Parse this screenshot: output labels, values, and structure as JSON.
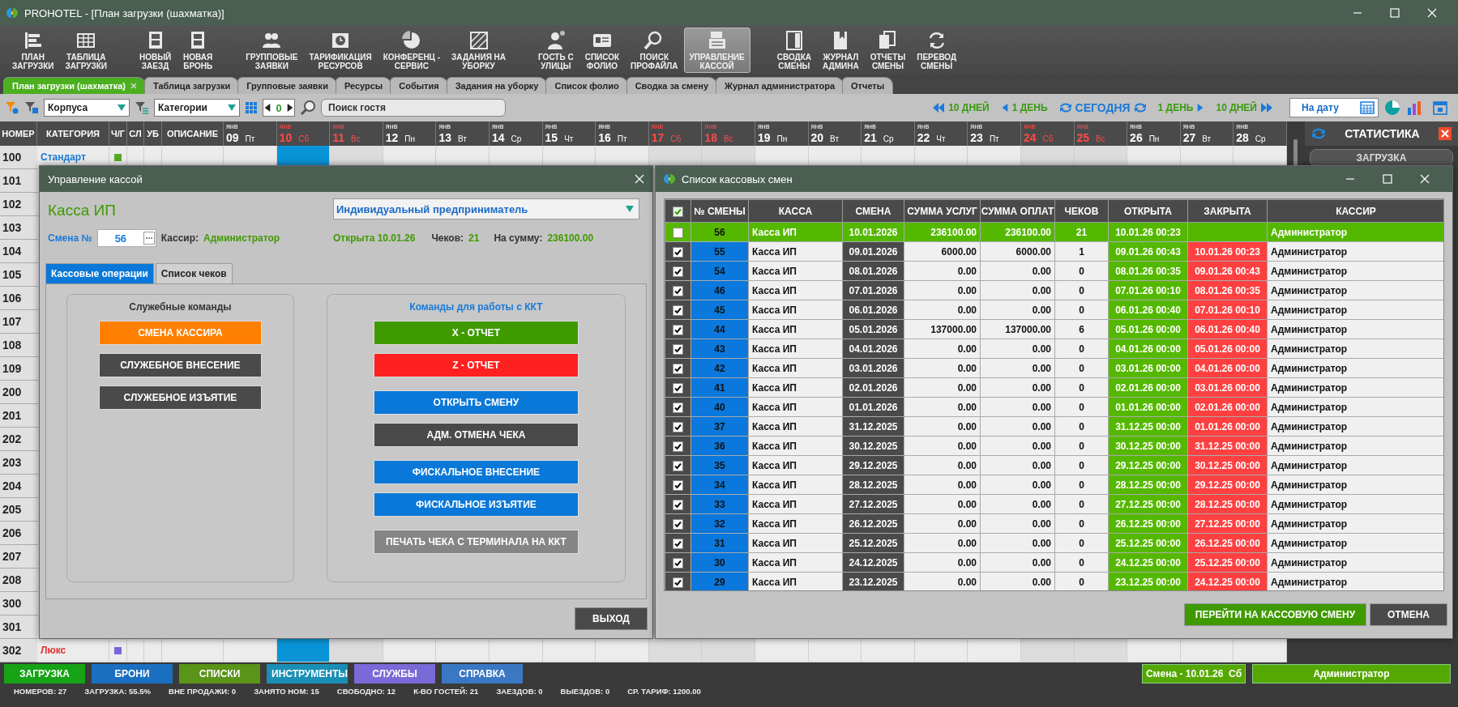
{
  "window": {
    "title": "PROHOTEL - [План загрузки (шахматка)]"
  },
  "toolbar": [
    {
      "label": "ПЛАН\nЗАГРУЗКИ",
      "selected": false
    },
    {
      "label": "ТАБЛИЦА\nЗАГРУЗКИ",
      "selected": false
    },
    {
      "label": "НОВЫЙ\nЗАЕЗД",
      "selected": false
    },
    {
      "label": "НОВАЯ\nБРОНЬ",
      "selected": false
    },
    {
      "label": "ГРУППОВЫЕ\nЗАЯВКИ",
      "selected": false
    },
    {
      "label": "ТАРИФИКАЦИЯ\nРЕСУРСОВ",
      "selected": false
    },
    {
      "label": "КОНФЕРЕНЦ -\nСЕРВИС",
      "selected": false
    },
    {
      "label": "ЗАДАНИЯ НА\nУБОРКУ",
      "selected": false
    },
    {
      "label": "ГОСТЬ С\nУЛИЦЫ",
      "selected": false
    },
    {
      "label": "СПИСОК\nФОЛИО",
      "selected": false
    },
    {
      "label": "ПОИСК\nПРОФАЙЛА",
      "selected": false
    },
    {
      "label": "УПРАВЛЕНИЕ\nКАССОЙ",
      "selected": true
    },
    {
      "label": "СВОДКА\nСМЕНЫ",
      "selected": false
    },
    {
      "label": "ЖУРНАЛ\nАДМИНА",
      "selected": false
    },
    {
      "label": "ОТЧЕТЫ\nСМЕНЫ",
      "selected": false
    },
    {
      "label": "ПЕРЕВОД\nСМЕНЫ",
      "selected": false
    }
  ],
  "tabs": [
    {
      "label": "План загрузки (шахматка)",
      "selected": true,
      "closable": true
    },
    {
      "label": "Таблица загрузки",
      "selected": false,
      "closable": false
    },
    {
      "label": "Групповые заявки",
      "selected": false,
      "closable": false
    },
    {
      "label": "Ресурсы",
      "selected": false,
      "closable": false
    },
    {
      "label": "События",
      "selected": false,
      "closable": false
    },
    {
      "label": "Задания на уборку",
      "selected": false,
      "closable": false
    },
    {
      "label": "Список фолио",
      "selected": false,
      "closable": false
    },
    {
      "label": "Сводка за смену",
      "selected": false,
      "closable": false
    },
    {
      "label": "Журнал администратора",
      "selected": false,
      "closable": false
    },
    {
      "label": "Отчеты",
      "selected": false,
      "closable": false
    }
  ],
  "filters": {
    "building": "Корпуса",
    "category": "Категории",
    "step": "0",
    "search_placeholder": "Поиск гостя"
  },
  "navigation": [
    {
      "label": "10 ДНЕЙ",
      "kind": "prev-double"
    },
    {
      "label": "1 ДЕНЬ",
      "kind": "prev"
    },
    {
      "label": "СЕГОДНЯ",
      "kind": "today"
    },
    {
      "label": "1 ДЕНЬ",
      "kind": "next"
    },
    {
      "label": "10 ДНЕЙ",
      "kind": "next-double"
    }
  ],
  "date_button": "На дату",
  "grid": {
    "columns": [
      "НОМЕР",
      "КАТЕГОРИЯ",
      "Ч/Г",
      "СЛ",
      "УБ",
      "ОПИСАНИЕ"
    ],
    "days": [
      {
        "month": "янв",
        "day": "09",
        "weekday": "Пт",
        "weekend": false
      },
      {
        "month": "янв",
        "day": "10",
        "weekday": "Сб",
        "weekend": true
      },
      {
        "month": "янв",
        "day": "11",
        "weekday": "Вс",
        "weekend": true
      },
      {
        "month": "янв",
        "day": "12",
        "weekday": "Пн",
        "weekend": false
      },
      {
        "month": "янв",
        "day": "13",
        "weekday": "Вт",
        "weekend": false
      },
      {
        "month": "янв",
        "day": "14",
        "weekday": "Ср",
        "weekend": false
      },
      {
        "month": "янв",
        "day": "15",
        "weekday": "Чт",
        "weekend": false
      },
      {
        "month": "янв",
        "day": "16",
        "weekday": "Пт",
        "weekend": false
      },
      {
        "month": "янв",
        "day": "17",
        "weekday": "Сб",
        "weekend": true
      },
      {
        "month": "янв",
        "day": "18",
        "weekday": "Вс",
        "weekend": true
      },
      {
        "month": "янв",
        "day": "19",
        "weekday": "Пн",
        "weekend": false
      },
      {
        "month": "янв",
        "day": "20",
        "weekday": "Вт",
        "weekend": false
      },
      {
        "month": "янв",
        "day": "21",
        "weekday": "Ср",
        "weekend": false
      },
      {
        "month": "янв",
        "day": "22",
        "weekday": "Чт",
        "weekend": false
      },
      {
        "month": "янв",
        "day": "23",
        "weekday": "Пт",
        "weekend": false
      },
      {
        "month": "янв",
        "day": "24",
        "weekday": "Сб",
        "weekend": true
      },
      {
        "month": "янв",
        "day": "25",
        "weekday": "Вс",
        "weekend": true
      },
      {
        "month": "янв",
        "day": "26",
        "weekday": "Пн",
        "weekend": false
      },
      {
        "month": "янв",
        "day": "27",
        "weekday": "Вт",
        "weekend": false
      },
      {
        "month": "янв",
        "day": "28",
        "weekday": "Ср",
        "weekend": false
      }
    ],
    "rows": [
      {
        "number": "100",
        "category": {
          "text": "Стандарт",
          "color": "#1a7ad8"
        },
        "marker": {
          "color": "#55aa22"
        },
        "cells": [
          {
            "booked": false
          },
          {
            "booked": true
          },
          {
            "booked": false
          },
          {
            "booked": false
          },
          {
            "booked": false
          },
          {
            "booked": false
          },
          {
            "booked": false
          },
          {
            "booked": false
          },
          {
            "booked": false
          },
          {
            "booked": false
          },
          {
            "booked": false
          },
          {
            "booked": false
          },
          {
            "booked": false
          },
          {
            "booked": false
          },
          {
            "booked": false
          },
          {
            "booked": false
          },
          {
            "booked": false
          },
          {
            "booked": false
          },
          {
            "booked": false
          },
          {
            "booked": false
          }
        ]
      },
      {
        "number": "101"
      },
      {
        "number": "102"
      },
      {
        "number": "103"
      },
      {
        "number": "104"
      },
      {
        "number": "105"
      },
      {
        "number": "106"
      },
      {
        "number": "107"
      },
      {
        "number": "108"
      },
      {
        "number": "109"
      },
      {
        "number": "200"
      },
      {
        "number": "201"
      },
      {
        "number": "202"
      },
      {
        "number": "203"
      },
      {
        "number": "204"
      },
      {
        "number": "205"
      },
      {
        "number": "206"
      },
      {
        "number": "207"
      },
      {
        "number": "208"
      },
      {
        "number": "300"
      },
      {
        "number": "301"
      },
      {
        "number": "302",
        "category": {
          "text": "Люкс",
          "color": "#e03030"
        },
        "marker": {
          "color": "#7a66d8"
        },
        "cells": [
          {
            "booked": false
          },
          {
            "booked": true
          },
          {
            "booked": false
          },
          {
            "booked": false
          },
          {
            "booked": false
          },
          {
            "booked": false
          },
          {
            "booked": false
          },
          {
            "booked": false
          },
          {
            "booked": false
          },
          {
            "booked": false
          },
          {
            "booked": false
          },
          {
            "booked": false
          },
          {
            "booked": false
          },
          {
            "booked": false
          },
          {
            "booked": false
          },
          {
            "booked": false
          },
          {
            "booked": false
          },
          {
            "booked": false
          },
          {
            "booked": false
          },
          {
            "booked": false
          }
        ]
      }
    ]
  },
  "statistics": {
    "title": "СТАТИСТИКА",
    "button": "ЗАГРУЗКА"
  },
  "cash_dialog": {
    "title": "Управление кассой",
    "register": "Касса ИП",
    "entity": "Индивидуальный предприниматель",
    "shift_label": "Смена №",
    "shift_number": "56",
    "cashier_label": "Кассир:",
    "cashier": "Администратор",
    "opened": "Открыта 10.01.26",
    "checks_label": "Чеков:",
    "checks": "21",
    "sum_label": "На сумму:",
    "sum": "236100.00",
    "tabs": [
      {
        "label": "Кассовые операции",
        "selected": true
      },
      {
        "label": "Список чеков",
        "selected": false
      }
    ],
    "groups": [
      {
        "title": "Служебные команды",
        "kind": "service",
        "button_sets": [
          [
            {
              "label": "СМЕНА КАССИРА",
              "color": "#ff8000"
            },
            {
              "label": "СЛУЖЕБНОЕ ВНЕСЕНИЕ",
              "color": "#4a4a4a"
            },
            {
              "label": "СЛУЖЕБНОЕ ИЗЪЯТИЕ",
              "color": "#4a4a4a"
            }
          ]
        ]
      },
      {
        "title": "Команды для работы с ККТ",
        "kind": "device",
        "button_sets": [
          [
            {
              "label": "X - ОТЧЕТ",
              "color": "#3f9a00"
            },
            {
              "label": "Z - ОТЧЕТ",
              "color": "#ff2020"
            }
          ],
          [
            {
              "label": "ОТКРЫТЬ СМЕНУ",
              "color": "#0a78d8"
            },
            {
              "label": "АДМ. ОТМЕНА ЧЕКА",
              "color": "#4a4a4a"
            }
          ],
          [
            {
              "label": "ФИСКАЛЬНОЕ ВНЕСЕНИЕ",
              "color": "#0a78d8"
            },
            {
              "label": "ФИСКАЛЬНОЕ ИЗЪЯТИЕ",
              "color": "#0a78d8"
            }
          ],
          [
            {
              "label": "ПЕЧАТЬ ЧЕКА С ТЕРМИНАЛА НА ККТ",
              "color": "#858585"
            }
          ]
        ]
      }
    ],
    "exit": "ВЫХОД"
  },
  "shifts_dialog": {
    "title": "Список кассовых смен",
    "header_checked": true,
    "columns": [
      "№ СМЕНЫ",
      "КАССА",
      "СМЕНА",
      "СУММА УСЛУГ",
      "СУММА ОПЛАТ",
      "ЧЕКОВ",
      "ОТКРЫТА",
      "ЗАКРЫТА",
      "КАССИР"
    ],
    "rows": [
      {
        "selected": true,
        "checked": false,
        "number": "56",
        "register": "Касса ИП",
        "date": "10.01.2026",
        "services": "236100.00",
        "payments": "236100.00",
        "checks": "21",
        "opened": "10.01.26 00:23",
        "cashier": "Администратор"
      },
      {
        "selected": false,
        "checked": true,
        "number": "55",
        "register": "Касса ИП",
        "date": "09.01.2026",
        "services": "6000.00",
        "payments": "6000.00",
        "checks": "1",
        "opened": "09.01.26 00:43",
        "closed": "10.01.26 00:23",
        "cashier": "Администратор"
      },
      {
        "selected": false,
        "checked": true,
        "number": "54",
        "register": "Касса ИП",
        "date": "08.01.2026",
        "services": "0.00",
        "payments": "0.00",
        "checks": "0",
        "opened": "08.01.26 00:35",
        "closed": "09.01.26 00:43",
        "cashier": "Администратор"
      },
      {
        "selected": false,
        "checked": true,
        "number": "46",
        "register": "Касса ИП",
        "date": "07.01.2026",
        "services": "0.00",
        "payments": "0.00",
        "checks": "0",
        "opened": "07.01.26 00:10",
        "closed": "08.01.26 00:35",
        "cashier": "Администратор"
      },
      {
        "selected": false,
        "checked": true,
        "number": "45",
        "register": "Касса ИП",
        "date": "06.01.2026",
        "services": "0.00",
        "payments": "0.00",
        "checks": "0",
        "opened": "06.01.26 00:40",
        "closed": "07.01.26 00:10",
        "cashier": "Администратор"
      },
      {
        "selected": false,
        "checked": true,
        "number": "44",
        "register": "Касса ИП",
        "date": "05.01.2026",
        "services": "137000.00",
        "payments": "137000.00",
        "checks": "6",
        "opened": "05.01.26 00:00",
        "closed": "06.01.26 00:40",
        "cashier": "Администратор"
      },
      {
        "selected": false,
        "checked": true,
        "number": "43",
        "register": "Касса ИП",
        "date": "04.01.2026",
        "services": "0.00",
        "payments": "0.00",
        "checks": "0",
        "opened": "04.01.26 00:00",
        "closed": "05.01.26 00:00",
        "cashier": "Администратор"
      },
      {
        "selected": false,
        "checked": true,
        "number": "42",
        "register": "Касса ИП",
        "date": "03.01.2026",
        "services": "0.00",
        "payments": "0.00",
        "checks": "0",
        "opened": "03.01.26 00:00",
        "closed": "04.01.26 00:00",
        "cashier": "Администратор"
      },
      {
        "selected": false,
        "checked": true,
        "number": "41",
        "register": "Касса ИП",
        "date": "02.01.2026",
        "services": "0.00",
        "payments": "0.00",
        "checks": "0",
        "opened": "02.01.26 00:00",
        "closed": "03.01.26 00:00",
        "cashier": "Администратор"
      },
      {
        "selected": false,
        "checked": true,
        "number": "40",
        "register": "Касса ИП",
        "date": "01.01.2026",
        "services": "0.00",
        "payments": "0.00",
        "checks": "0",
        "opened": "01.01.26 00:00",
        "closed": "02.01.26 00:00",
        "cashier": "Администратор"
      },
      {
        "selected": false,
        "checked": true,
        "number": "37",
        "register": "Касса ИП",
        "date": "31.12.2025",
        "services": "0.00",
        "payments": "0.00",
        "checks": "0",
        "opened": "31.12.25 00:00",
        "closed": "01.01.26 00:00",
        "cashier": "Администратор"
      },
      {
        "selected": false,
        "checked": true,
        "number": "36",
        "register": "Касса ИП",
        "date": "30.12.2025",
        "services": "0.00",
        "payments": "0.00",
        "checks": "0",
        "opened": "30.12.25 00:00",
        "closed": "31.12.25 00:00",
        "cashier": "Администратор"
      },
      {
        "selected": false,
        "checked": true,
        "number": "35",
        "register": "Касса ИП",
        "date": "29.12.2025",
        "services": "0.00",
        "payments": "0.00",
        "checks": "0",
        "opened": "29.12.25 00:00",
        "closed": "30.12.25 00:00",
        "cashier": "Администратор"
      },
      {
        "selected": false,
        "checked": true,
        "number": "34",
        "register": "Касса ИП",
        "date": "28.12.2025",
        "services": "0.00",
        "payments": "0.00",
        "checks": "0",
        "opened": "28.12.25 00:00",
        "closed": "29.12.25 00:00",
        "cashier": "Администратор"
      },
      {
        "selected": false,
        "checked": true,
        "number": "33",
        "register": "Касса ИП",
        "date": "27.12.2025",
        "services": "0.00",
        "payments": "0.00",
        "checks": "0",
        "opened": "27.12.25 00:00",
        "closed": "28.12.25 00:00",
        "cashier": "Администратор"
      },
      {
        "selected": false,
        "checked": true,
        "number": "32",
        "register": "Касса ИП",
        "date": "26.12.2025",
        "services": "0.00",
        "payments": "0.00",
        "checks": "0",
        "opened": "26.12.25 00:00",
        "closed": "27.12.25 00:00",
        "cashier": "Администратор"
      },
      {
        "selected": false,
        "checked": true,
        "number": "31",
        "register": "Касса ИП",
        "date": "25.12.2025",
        "services": "0.00",
        "payments": "0.00",
        "checks": "0",
        "opened": "25.12.25 00:00",
        "closed": "26.12.25 00:00",
        "cashier": "Администратор"
      },
      {
        "selected": false,
        "checked": true,
        "number": "30",
        "register": "Касса ИП",
        "date": "24.12.2025",
        "services": "0.00",
        "payments": "0.00",
        "checks": "0",
        "opened": "24.12.25 00:00",
        "closed": "25.12.25 00:00",
        "cashier": "Администратор"
      },
      {
        "selected": false,
        "checked": true,
        "number": "29",
        "register": "Касса ИП",
        "date": "23.12.2025",
        "services": "0.00",
        "payments": "0.00",
        "checks": "0",
        "opened": "23.12.25 00:00",
        "closed": "24.12.25 00:00",
        "cashier": "Администратор"
      }
    ],
    "buttons": [
      {
        "label": "ПЕРЕЙТИ НА КАССОВУЮ СМЕНУ",
        "kind": "primary"
      },
      {
        "label": "ОТМЕНА",
        "kind": "secondary"
      }
    ]
  },
  "modules": [
    {
      "label": "ЗАГРУЗКА",
      "color": "#16a316"
    },
    {
      "label": "БРОНИ",
      "color": "#1a6fc0"
    },
    {
      "label": "СПИСКИ",
      "color": "#5a9418"
    },
    {
      "label": "ИНСТРУМЕНТЫ",
      "color": "#1a8fb5"
    },
    {
      "label": "СЛУЖБЫ",
      "color": "#7a6ad8"
    },
    {
      "label": "СПРАВКА",
      "color": "#3a78c4"
    }
  ],
  "shift_badge": "Смена - 10.01.26  Сб",
  "user": "Администратор",
  "status_bar": [
    "НОМЕРОВ: 27",
    "ЗАГРУЗКА: 55.5%",
    "ВНЕ ПРОДАЖИ: 0",
    "ЗАНЯТО НОМ: 15",
    "СВОБОДНО: 12",
    "К-ВО ГОСТЕЙ: 21",
    "ЗАЕЗДОВ: 0",
    "ВЫЕЗДОВ: 0",
    "СР. ТАРИФ: 1200.00"
  ]
}
